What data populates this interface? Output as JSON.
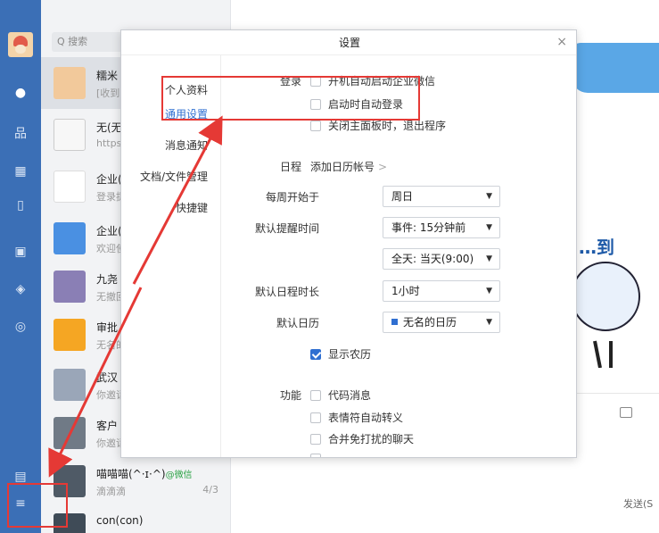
{
  "search": {
    "placeholder": "Q 搜索"
  },
  "chats": [
    {
      "name": "糯米",
      "preview": "[收到",
      "count": ""
    },
    {
      "name": "无(无",
      "preview": "https",
      "count": ""
    },
    {
      "name": "企业(",
      "preview": "登录提",
      "count": ""
    },
    {
      "name": "企业(",
      "preview": "欢迎使",
      "count": ""
    },
    {
      "name": "九尧",
      "preview": "无撤回",
      "count": ""
    },
    {
      "name": "审批",
      "preview": "无名的",
      "count": ""
    },
    {
      "name": "武汉",
      "preview": "你邀请",
      "count": ""
    },
    {
      "name": "客户",
      "preview": "你邀请",
      "count": ""
    },
    {
      "name": "喵喵喵(^·ɪ·^)",
      "tag": "@微信",
      "preview": "滴滴滴",
      "count": "4/3"
    },
    {
      "name": "con(con)",
      "preview": "",
      "count": ""
    }
  ],
  "dialog": {
    "title": "设置",
    "close": "×",
    "nav": [
      "个人资料",
      "通用设置",
      "消息通知",
      "文档/文件管理",
      "快捷键"
    ],
    "login": {
      "section": "登录",
      "options": [
        {
          "label": "开机自动启动企业微信",
          "checked": false
        },
        {
          "label": "启动时自动登录",
          "checked": false
        },
        {
          "label": "关闭主面板时，退出程序",
          "checked": false
        }
      ]
    },
    "calendar": {
      "section": "日程",
      "add_account": "添加日历帐号",
      "week_start": {
        "label": "每周开始于",
        "value": "周日"
      },
      "reminder": {
        "label": "默认提醒时间",
        "value": "事件: 15分钟前",
        "value2": "全天: 当天(9:00)"
      },
      "duration": {
        "label": "默认日程时长",
        "value": "1小时"
      },
      "default_cal": {
        "label": "默认日历",
        "value": "无名的日历"
      },
      "lunar": {
        "label": "显示农历",
        "checked": true
      }
    },
    "features": {
      "section": "功能",
      "options": [
        {
          "label": "代码消息",
          "checked": false
        },
        {
          "label": "表情符自动转义",
          "checked": false
        },
        {
          "label": "合并免打扰的聊天",
          "checked": false
        }
      ]
    }
  },
  "main": {
    "send": "发送(S"
  },
  "colors": {
    "rail": "#3b6fb6",
    "accent": "#2f6fd1",
    "annotation": "#e53935"
  }
}
